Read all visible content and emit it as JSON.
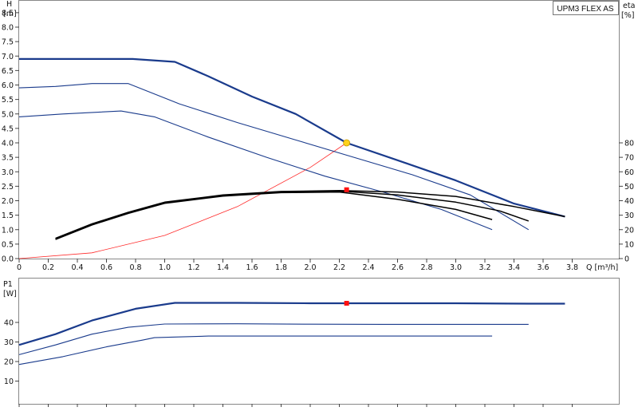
{
  "chart_data": [
    {
      "type": "line",
      "title": "UPM3 FLEX AS",
      "xlabel": "Q [m³/h]",
      "ylabel": "H [m]",
      "ylabel_right": "eta [%]",
      "xlim": [
        0,
        4.0
      ],
      "ylim": [
        0,
        9.0
      ],
      "ylim_right": [
        0,
        80
      ],
      "x_ticks": [
        "0",
        "0.2",
        "0.4",
        "0.6",
        "0.8",
        "1.0",
        "1.2",
        "1.4",
        "1.6",
        "1.8",
        "2.0",
        "2.2",
        "2.4",
        "2.6",
        "2.8",
        "3.0",
        "3.2",
        "3.4",
        "3.6",
        "3.8"
      ],
      "y_ticks": [
        "0.0",
        "0.5",
        "1.0",
        "1.5",
        "2.0",
        "2.5",
        "3.0",
        "3.5",
        "4.0",
        "4.5",
        "5.0",
        "5.5",
        "6.0",
        "6.5",
        "7.0",
        "7.5",
        "8.0",
        "8.5"
      ],
      "y_right_ticks": [
        "0",
        "10",
        "20",
        "30",
        "40",
        "50",
        "60",
        "70",
        "80"
      ],
      "grid": false,
      "head_curves": [
        {
          "points": [
            [
              0,
              6.9
            ],
            [
              0.5,
              6.9
            ],
            [
              0.78,
              6.9
            ],
            [
              1.07,
              6.8
            ],
            [
              1.3,
              6.3
            ],
            [
              1.6,
              5.6
            ],
            [
              1.9,
              5.0
            ],
            [
              2.25,
              4.0
            ],
            [
              2.6,
              3.4
            ],
            [
              3.0,
              2.7
            ],
            [
              3.4,
              1.9
            ],
            [
              3.75,
              1.45
            ]
          ],
          "emphasis": "bold"
        },
        {
          "points": [
            [
              0,
              5.9
            ],
            [
              0.25,
              5.95
            ],
            [
              0.5,
              6.05
            ],
            [
              0.75,
              6.05
            ],
            [
              1.1,
              5.35
            ],
            [
              1.5,
              4.7
            ],
            [
              1.9,
              4.1
            ],
            [
              2.3,
              3.5
            ],
            [
              2.7,
              2.9
            ],
            [
              3.1,
              2.2
            ],
            [
              3.5,
              1.0
            ]
          ],
          "emphasis": "normal"
        },
        {
          "points": [
            [
              0,
              4.9
            ],
            [
              0.3,
              5.0
            ],
            [
              0.7,
              5.1
            ],
            [
              0.93,
              4.9
            ],
            [
              1.3,
              4.2
            ],
            [
              1.7,
              3.5
            ],
            [
              2.1,
              2.85
            ],
            [
              2.5,
              2.3
            ],
            [
              2.9,
              1.7
            ],
            [
              3.25,
              1.0
            ]
          ],
          "emphasis": "normal"
        }
      ],
      "efficiency_curves": [
        {
          "points": [
            [
              0.25,
              0.7
            ],
            [
              0.5,
              1.2
            ],
            [
              0.75,
              1.6
            ],
            [
              1.0,
              1.95
            ],
            [
              1.4,
              2.2
            ],
            [
              1.8,
              2.32
            ],
            [
              2.2,
              2.35
            ],
            [
              2.6,
              2.3
            ],
            [
              3.0,
              2.15
            ],
            [
              3.4,
              1.8
            ],
            [
              3.75,
              1.45
            ]
          ]
        },
        {
          "points": [
            [
              0.25,
              0.68
            ],
            [
              0.5,
              1.18
            ],
            [
              0.75,
              1.58
            ],
            [
              1.0,
              1.93
            ],
            [
              1.4,
              2.18
            ],
            [
              1.8,
              2.3
            ],
            [
              2.2,
              2.33
            ],
            [
              2.6,
              2.2
            ],
            [
              3.0,
              1.95
            ],
            [
              3.3,
              1.65
            ],
            [
              3.5,
              1.3
            ]
          ]
        },
        {
          "points": [
            [
              0.25,
              0.66
            ],
            [
              0.5,
              1.16
            ],
            [
              0.75,
              1.56
            ],
            [
              1.0,
              1.91
            ],
            [
              1.4,
              2.16
            ],
            [
              1.8,
              2.28
            ],
            [
              2.2,
              2.3
            ],
            [
              2.6,
              2.05
            ],
            [
              3.0,
              1.7
            ],
            [
              3.25,
              1.35
            ]
          ]
        }
      ],
      "system_curve": {
        "points": [
          [
            0,
            0
          ],
          [
            0.5,
            0.2
          ],
          [
            1.0,
            0.8
          ],
          [
            1.5,
            1.8
          ],
          [
            2.0,
            3.15
          ],
          [
            2.25,
            4.0
          ]
        ]
      },
      "duty_point": {
        "x": 2.25,
        "y": 4.0,
        "color": "#ffd21a"
      },
      "efficiency_point": {
        "x": 2.25,
        "y": 2.38,
        "color": "#ff1010"
      }
    },
    {
      "type": "line",
      "ylabel": "P1 [W]",
      "xlim": [
        0,
        4.0
      ],
      "ylim": [
        0,
        50
      ],
      "y_ticks": [
        "10",
        "20",
        "30",
        "40"
      ],
      "grid": false,
      "power_curves": [
        {
          "points": [
            [
              0,
              28.5
            ],
            [
              0.25,
              34
            ],
            [
              0.5,
              41
            ],
            [
              0.8,
              47
            ],
            [
              1.07,
              50
            ],
            [
              1.5,
              50
            ],
            [
              2.0,
              49.8
            ],
            [
              2.5,
              49.8
            ],
            [
              3.0,
              49.8
            ],
            [
              3.5,
              49.6
            ],
            [
              3.75,
              49.6
            ]
          ],
          "emphasis": "bold"
        },
        {
          "points": [
            [
              0,
              23.5
            ],
            [
              0.25,
              28.5
            ],
            [
              0.5,
              34
            ],
            [
              0.75,
              37.5
            ],
            [
              1.0,
              39.2
            ],
            [
              1.5,
              39.3
            ],
            [
              2.0,
              39.1
            ],
            [
              2.5,
              39.0
            ],
            [
              3.0,
              39.0
            ],
            [
              3.5,
              39.0
            ]
          ],
          "emphasis": "normal"
        },
        {
          "points": [
            [
              0,
              18.5
            ],
            [
              0.3,
              22.5
            ],
            [
              0.6,
              27.5
            ],
            [
              0.85,
              31
            ],
            [
              0.93,
              32.2
            ],
            [
              1.3,
              33
            ],
            [
              2.0,
              33
            ],
            [
              2.6,
              33
            ],
            [
              3.25,
              33
            ]
          ],
          "emphasis": "normal"
        }
      ],
      "operating_point": {
        "x": 2.25,
        "y": 49.8,
        "color": "#ff1010"
      }
    }
  ]
}
